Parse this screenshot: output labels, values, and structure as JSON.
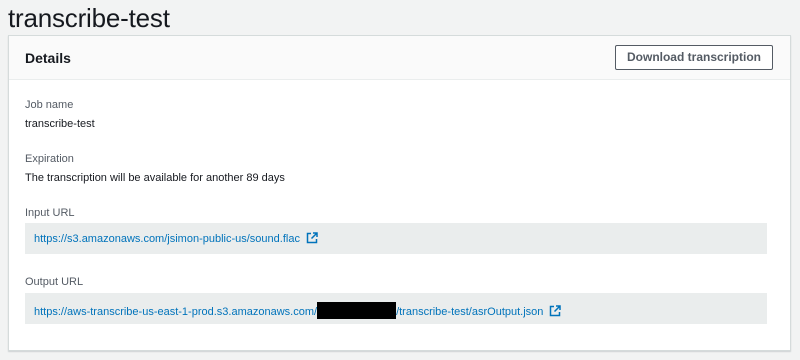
{
  "page": {
    "title": "transcribe-test"
  },
  "details": {
    "title": "Details",
    "download_button": "Download transcription",
    "job_name": {
      "label": "Job name",
      "value": "transcribe-test"
    },
    "expiration": {
      "label": "Expiration",
      "value": "The transcription will be available for another 89 days"
    },
    "input_url": {
      "label": "Input URL",
      "value": "https://s3.amazonaws.com/jsimon-public-us/sound.flac",
      "icon": "external-link-icon"
    },
    "output_url": {
      "label": "Output URL",
      "value_prefix": "https://aws-transcribe-us-east-1-prod.s3.amazonaws.com/",
      "value_suffix": "/transcribe-test/asrOutput.json",
      "icon": "external-link-icon"
    }
  },
  "colors": {
    "link": "#0073bb",
    "background": "#f2f3f3",
    "url_box": "#eaeded",
    "button_border": "#545b64"
  }
}
